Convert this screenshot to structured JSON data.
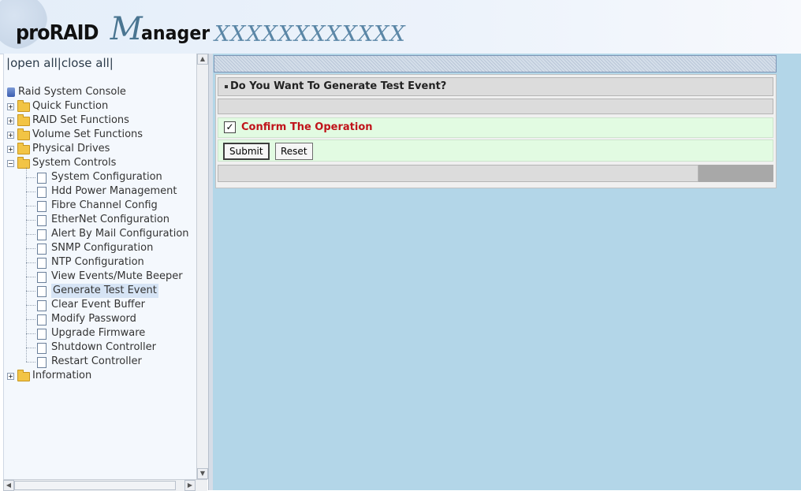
{
  "header": {
    "logo_pro": "proRAID",
    "logo_script": "M",
    "logo_rest": "anager",
    "device_name": "XXXXXXXXXXXX"
  },
  "sidebar": {
    "open_all": "open all",
    "close_all": "close all",
    "sep": "|",
    "root": "Raid System Console",
    "folders": [
      {
        "label": "Quick Function"
      },
      {
        "label": "RAID Set Functions"
      },
      {
        "label": "Volume Set Functions"
      },
      {
        "label": "Physical Drives"
      },
      {
        "label": "System Controls"
      }
    ],
    "system_controls": [
      "System Configuration",
      "Hdd Power Management",
      "Fibre Channel Config",
      "EtherNet Configuration",
      "Alert By Mail Configuration",
      "SNMP Configuration",
      "NTP Configuration",
      "View Events/Mute Beeper",
      "Generate Test Event",
      "Clear Event Buffer",
      "Modify Password",
      "Upgrade Firmware",
      "Shutdown Controller",
      "Restart Controller"
    ],
    "information": "Information",
    "selected": "Generate Test Event"
  },
  "main": {
    "question": "Do You Want To Generate Test Event?",
    "confirm_label": "Confirm The Operation",
    "confirm_checked": true,
    "submit_label": "Submit",
    "reset_label": "Reset"
  },
  "colors": {
    "content_bg": "#b3d6e8",
    "confirm_text": "#c0131a",
    "confirm_row_bg": "#e2fbe2"
  }
}
